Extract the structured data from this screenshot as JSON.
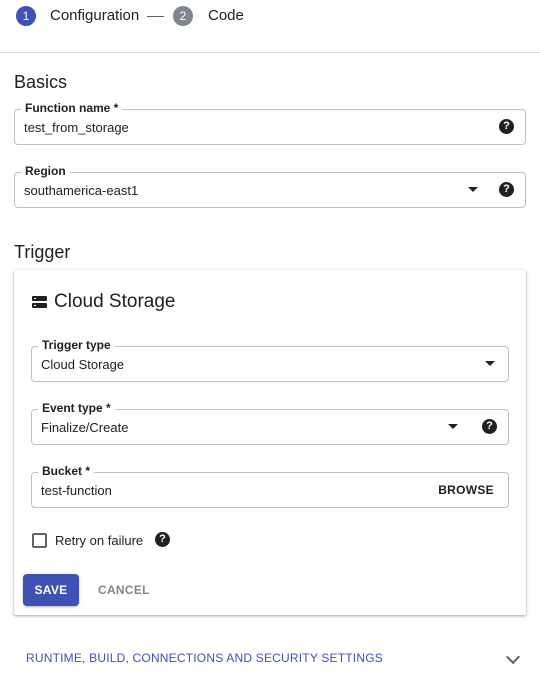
{
  "stepper": {
    "step1": {
      "number": "1",
      "label": "Configuration"
    },
    "step2": {
      "number": "2",
      "label": "Code"
    }
  },
  "basics": {
    "title": "Basics",
    "function_name": {
      "label": "Function name *",
      "value": "test_from_storage"
    },
    "region": {
      "label": "Region",
      "value": "southamerica-east1"
    }
  },
  "trigger": {
    "title": "Trigger",
    "card_title": "Cloud Storage",
    "trigger_type": {
      "label": "Trigger type",
      "value": "Cloud Storage"
    },
    "event_type": {
      "label": "Event type *",
      "value": "Finalize/Create"
    },
    "bucket": {
      "label": "Bucket *",
      "value": "test-function",
      "browse_label": "BROWSE"
    },
    "retry": {
      "label": "Retry on failure",
      "checked": false
    },
    "save_label": "SAVE",
    "cancel_label": "CANCEL"
  },
  "advanced": {
    "label": "RUNTIME, BUILD, CONNECTIONS AND SECURITY SETTINGS"
  },
  "colors": {
    "accent": "#3f51b5",
    "inactive_step": "#80868b"
  },
  "icons": {
    "help": "help-circle-icon",
    "dropdown": "caret-down-icon",
    "storage": "storage-icon",
    "expand": "chevron-down-icon"
  }
}
